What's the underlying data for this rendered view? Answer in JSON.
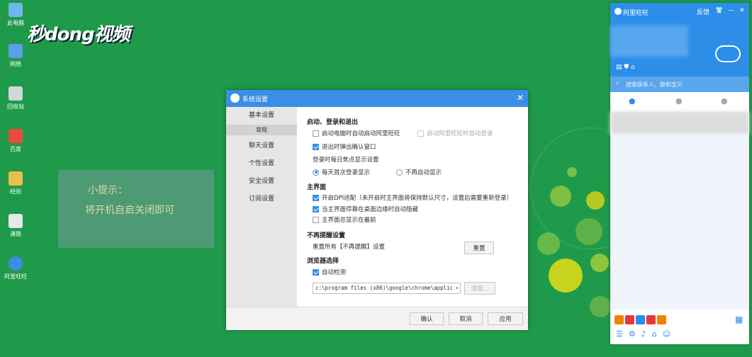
{
  "desktop": {
    "icons": [
      {
        "label": "此电脑",
        "icon": "computer-icon",
        "color": "#6fb6f0"
      },
      {
        "label": "网络",
        "icon": "network-icon",
        "color": "#5aa0e8"
      },
      {
        "label": "回收站",
        "icon": "recycle-bin-icon",
        "color": "#cfd8dc"
      },
      {
        "label": "百度",
        "icon": "baidu-icon",
        "color": "#e84b3c"
      },
      {
        "label": "经验",
        "icon": "experience-icon",
        "color": "#e8c04b"
      },
      {
        "label": "课题",
        "icon": "book-icon",
        "color": "#e8e8e8"
      },
      {
        "label": "阿里旺旺",
        "icon": "aliwangwang-icon",
        "color": "#3a8ee6"
      }
    ],
    "watermark": "秒dong视频",
    "tip": {
      "title": "小提示：",
      "text": "将开机自启关闭即可"
    }
  },
  "settings": {
    "title": "系统设置",
    "nav": {
      "basic": "基本设置",
      "normal": "常规",
      "chat": "聊天设置",
      "personal": "个性设置",
      "security": "安全设置",
      "subscribe": "订阅设置"
    },
    "startup": {
      "heading": "启动、登录和退出",
      "auto_start": "启动电脑时自动启动阿里旺旺",
      "auto_login": "启动阿里旺旺时自动登录",
      "exit_confirm": "退出时弹出确认窗口",
      "daily_label": "登录时每日焦点显示设置",
      "daily_first": "每天首次登录显示",
      "no_auto": "不再自动显示"
    },
    "main": {
      "heading": "主界面",
      "dpi": "开启DPI适配（未开启时主界面将保持默认尺寸，设置后需要重新登录）",
      "auto_hide": "当主界面停靠在桌面边缘时自动隐藏",
      "always_top": "主界面总显示在最前"
    },
    "noremind": {
      "heading": "不再提醒设置",
      "text": "重置所有【不再提醒】设置",
      "reset": "重置"
    },
    "browser": {
      "heading": "浏览器选择",
      "auto_detect": "自动检测",
      "path": "c:\\program files (x86)\\google\\chrome\\applic",
      "browse": "浏览..."
    },
    "footer": {
      "ok": "确认",
      "cancel": "取消",
      "apply": "应用"
    }
  },
  "wangwang": {
    "title": "阿里旺旺",
    "feedback": "反馈",
    "search_placeholder": "搜索联系人、群和宝贝",
    "accent": "#2c8ee8"
  }
}
